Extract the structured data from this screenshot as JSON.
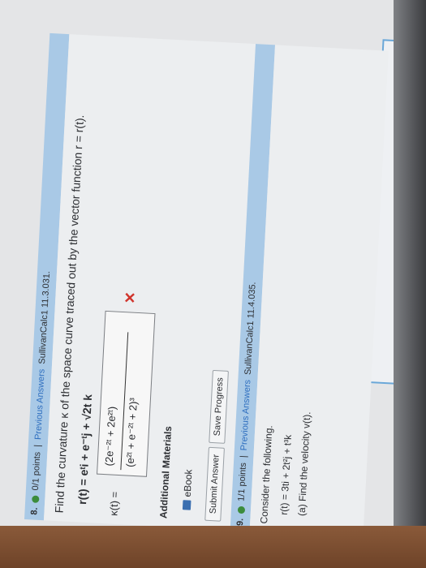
{
  "top": {
    "ebook_label": "eBook"
  },
  "question8": {
    "number": "8.",
    "points": "0/1 points",
    "separator": "|",
    "previous_answers": "Previous Answers",
    "source": "SullivanCalc1 11.3.031.",
    "prompt": "Find the curvature κ of the space curve traced out by the vector function r = r(t).",
    "function": "r(t) = eᵗi + e⁻ᵗj + √2t k",
    "kappa_label": "κ(t) =",
    "answer_numerator": "(2e⁻²ᵗ + 2e²ᵗ)",
    "answer_denominator": "(e²ᵗ + e⁻²ᵗ + 2)³",
    "additional_materials": "Additional Materials",
    "ebook_label": "eBook",
    "submit_label": "Submit Answer",
    "save_label": "Save Progress"
  },
  "question9": {
    "number": "9.",
    "points": "1/1 points",
    "separator": "|",
    "previous_answers": "Previous Answers",
    "source": "SullivanCalc1 11.4.035.",
    "prompt": "Consider the following.",
    "function": "r(t) = 3ti + 2t²j + t³k",
    "part_a": "(a) Find the velocity v(t)."
  },
  "colors": {
    "bar": "#a9c9e6",
    "link": "#2f6fbf",
    "wrong": "#d0342c",
    "correct": "#3c8c3c"
  }
}
